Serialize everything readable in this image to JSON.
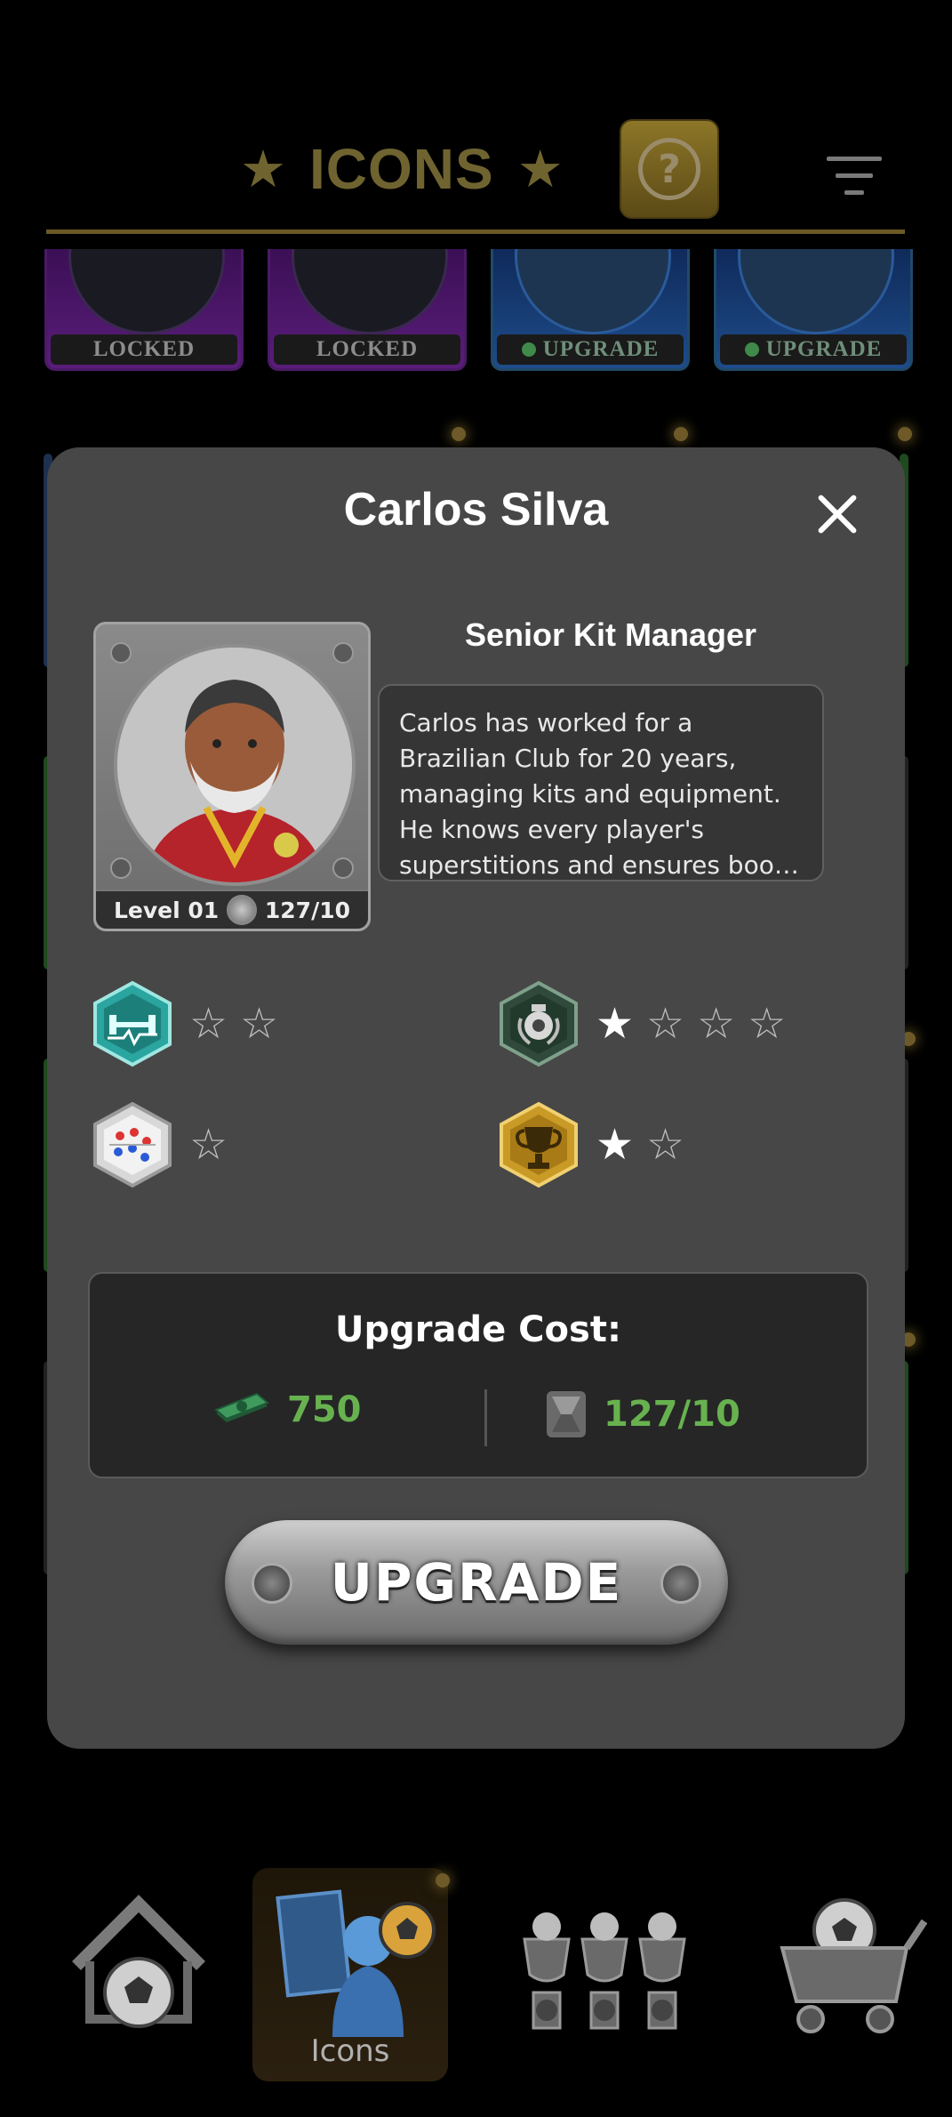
{
  "header": {
    "title": "ICONS",
    "help_glyph": "?",
    "icons": [
      "star-icon",
      "help-icon",
      "filter-icon"
    ]
  },
  "cards": [
    {
      "label": "LOCKED",
      "state": "locked"
    },
    {
      "label": "LOCKED",
      "state": "locked"
    },
    {
      "label": "UPGRADE",
      "state": "upgrade"
    },
    {
      "label": "UPGRADE",
      "state": "upgrade"
    }
  ],
  "modal": {
    "name": "Carlos Silva",
    "role": "Senior Kit Manager",
    "bio": "Carlos has worked for a Brazilian Club for 20 years, managing kits and equipment. He knows every player's superstitions and ensures boots are always polished for matches.",
    "level": "Level 01",
    "progress": "127/10",
    "stats": [
      {
        "icon": "fitness-icon",
        "filled": 0,
        "total": 2
      },
      {
        "icon": "emblem-icon",
        "filled": 1,
        "total": 4
      },
      {
        "icon": "tactics-board-icon",
        "filled": 0,
        "total": 1
      },
      {
        "icon": "trophy-icon",
        "filled": 1,
        "total": 2
      }
    ],
    "cost": {
      "title": "Upgrade Cost:",
      "cash": "750",
      "shards": "127/10"
    },
    "upgrade_label": "UPGRADE"
  },
  "nav": {
    "items": [
      {
        "name": "home",
        "icon": "home-ball-icon"
      },
      {
        "name": "icons",
        "icon": "icons-manager-icon",
        "label": "Icons",
        "active": true
      },
      {
        "name": "trophies",
        "icon": "trophies-icon"
      },
      {
        "name": "shop",
        "icon": "shop-cart-icon"
      }
    ]
  },
  "colors": {
    "accent_gold": "#6f6330",
    "cost_green": "#67b24f",
    "modal_bg": "#474747"
  }
}
